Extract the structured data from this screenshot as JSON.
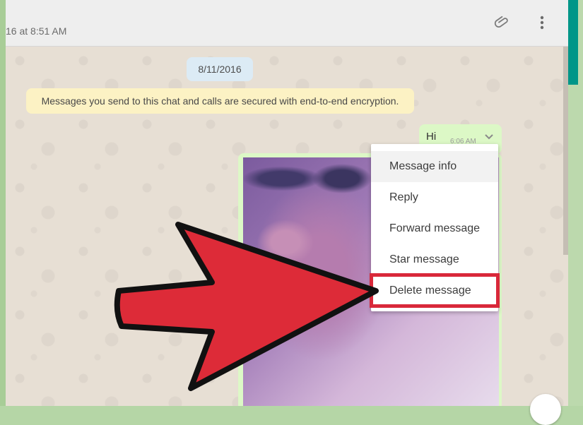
{
  "header": {
    "last_seen": "16 at 8:51 AM",
    "icons": [
      "paperclip-icon",
      "menu-dots-icon"
    ]
  },
  "chat": {
    "date_chip": "8/11/2016",
    "encryption_notice": "Messages you send to this chat and calls are secured with end-to-end encryption.",
    "message": {
      "text": "Hi",
      "time": "6:06 AM"
    }
  },
  "context_menu": {
    "items": [
      {
        "label": "Message info"
      },
      {
        "label": "Reply"
      },
      {
        "label": "Forward message"
      },
      {
        "label": "Star message"
      },
      {
        "label": "Delete message"
      }
    ],
    "highlighted": "Delete message"
  },
  "colors": {
    "incoming_bubble": "#dcf8c6",
    "encryption_bg": "#fcf2c4",
    "date_chip_bg": "#dcebf5",
    "annotation_red": "#d9283a",
    "accent_teal": "#009688"
  }
}
